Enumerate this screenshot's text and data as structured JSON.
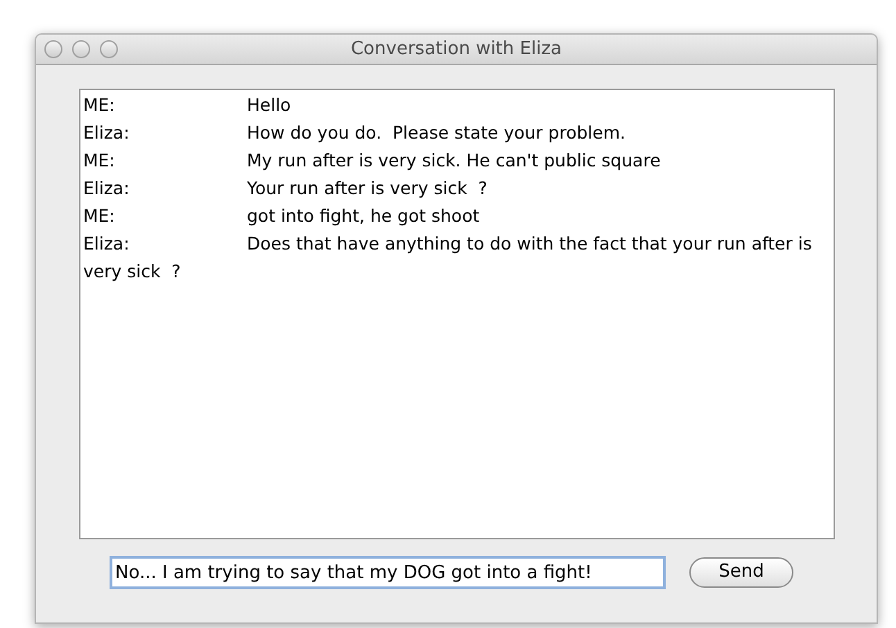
{
  "window": {
    "title": "Conversation with Eliza"
  },
  "transcript": [
    {
      "speaker": "ME:",
      "text": "Hello"
    },
    {
      "speaker": "Eliza:",
      "text": "How do you do.  Please state your problem."
    },
    {
      "speaker": "ME:",
      "text": "My run after is very sick. He can't public square"
    },
    {
      "speaker": "Eliza:",
      "text": "Your run after is very sick  ?"
    },
    {
      "speaker": "ME:",
      "text": "got into fight, he got shoot"
    },
    {
      "speaker": "Eliza:",
      "text": "Does that have anything to do with the fact that your run after is very sick  ?"
    }
  ],
  "input": {
    "value": "No... I am trying to say that my DOG got into a fight!"
  },
  "send_button": {
    "label": "Send"
  }
}
